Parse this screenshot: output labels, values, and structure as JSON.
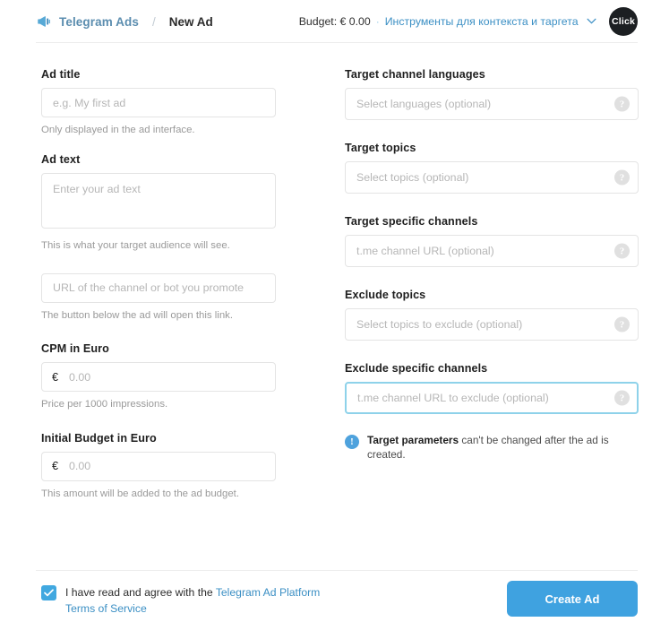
{
  "header": {
    "brand_icon": "megaphone-icon",
    "brand": "Telegram Ads",
    "separator": "/",
    "current": "New Ad",
    "budget": "Budget: € 0.00",
    "dot": "·",
    "tools_link": "Инструменты для контекста и таргета",
    "chevron": "chevron-down-icon",
    "avatar": "Click"
  },
  "left": {
    "ad_title": {
      "label": "Ad title",
      "placeholder": "e.g. My first ad",
      "value": "",
      "hint": "Only displayed in the ad interface."
    },
    "ad_text": {
      "label": "Ad text",
      "placeholder": "Enter your ad text",
      "value": "",
      "hint": "This is what your target audience will see."
    },
    "url": {
      "placeholder": "URL of the channel or bot you promote",
      "value": "",
      "hint": "The button below the ad will open this link."
    },
    "cpm": {
      "label": "CPM in Euro",
      "currency": "€",
      "placeholder": "0.00",
      "value": "",
      "hint": "Price per 1000 impressions."
    },
    "initial_budget": {
      "label": "Initial Budget in Euro",
      "currency": "€",
      "placeholder": "0.00",
      "value": "",
      "hint": "This amount will be added to the ad budget."
    }
  },
  "right": {
    "languages": {
      "label": "Target channel languages",
      "placeholder": "Select languages (optional)",
      "value": "",
      "help": "?"
    },
    "topics": {
      "label": "Target topics",
      "placeholder": "Select topics (optional)",
      "value": "",
      "help": "?"
    },
    "specific_channels": {
      "label": "Target specific channels",
      "placeholder": "t.me channel URL (optional)",
      "value": "",
      "help": "?"
    },
    "exclude_topics": {
      "label": "Exclude topics",
      "placeholder": "Select topics to exclude (optional)",
      "value": "",
      "help": "?"
    },
    "exclude_channels": {
      "label": "Exclude specific channels",
      "placeholder": "t.me channel URL to exclude (optional)",
      "value": "",
      "help": "?",
      "focused": true
    },
    "notice": {
      "icon": "info-icon",
      "bold": "Target parameters",
      "rest": " can't be changed after the ad is created."
    }
  },
  "footer": {
    "checkbox_checked": true,
    "terms_prefix": "I have read and agree with the ",
    "terms_link": "Telegram Ad Platform Terms of Service",
    "create_button": "Create Ad"
  },
  "colors": {
    "accent_blue": "#3fa2e0",
    "link_blue": "#3b8fc4",
    "brand_blue": "#5b8daf",
    "focus_border": "#8ed2ea",
    "checkbox": "#41a8e0",
    "avatar_bg": "#1c1f22"
  }
}
